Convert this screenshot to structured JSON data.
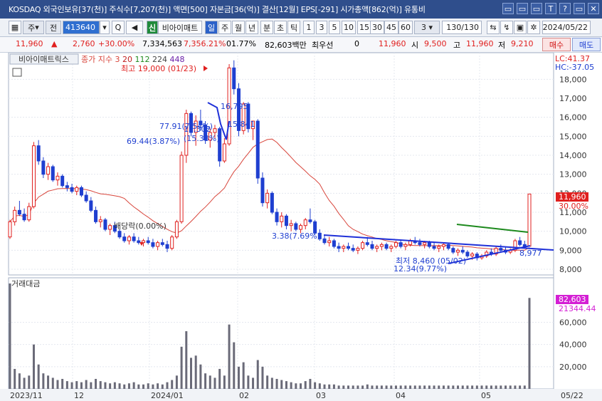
{
  "titlebar": {
    "title": "KOSDAQ 외국인보유[37(천)] 주식수[7,207(천)] 액면[500] 자본금[36(억)] 결산[12월] EPS[-291] 시가총액[862(억)] 유통비",
    "buttons": [
      "▭",
      "▭",
      "▭",
      "T",
      "?",
      "│",
      "▭",
      "✕"
    ]
  },
  "toolbar": {
    "grid_icon": "▦",
    "dropdown_1": "주",
    "dropdown_2": "전",
    "code": "413640",
    "zoom_icon": "Q",
    "speaker_icon": "◀",
    "badge": "신",
    "stock_name": "비아이매트",
    "periods": [
      "일",
      "주",
      "월",
      "년",
      "분",
      "초",
      "틱"
    ],
    "intervals": [
      "1",
      "3",
      "5",
      "10",
      "15",
      "30",
      "45",
      "60"
    ],
    "interval_select": "3",
    "count": "130",
    "count_total": "/130",
    "date": "2024/05/22"
  },
  "pricebar": {
    "price": "11,960",
    "change": "2,760",
    "change_pct": "+30.00%",
    "volume": "7,334,563",
    "volume_pct": "7,356.21%",
    "turnover": "01.77%",
    "trade_value": "82,603백만",
    "priority_label": "최우선",
    "priority_value": "0",
    "current": "11,960",
    "open_label": "시",
    "open": "9,500",
    "high_label": "고",
    "high": "11,960",
    "low_label": "저",
    "low": "9,210",
    "buy": "매수",
    "sell": "매도"
  },
  "chart": {
    "stock_label": "비아이매트릭스",
    "ma_legend_prefix": "종가 지수",
    "ma_periods": [
      "3",
      "20",
      "112",
      "224",
      "448"
    ],
    "lc_label": "LC:41.37",
    "hc_label": "HC:-37.05",
    "price_axis": [
      "18,000",
      "17,000",
      "16,000",
      "15,000",
      "14,000",
      "13,000",
      "12,000",
      "11,000",
      "10,000",
      "9,000",
      "8,000"
    ],
    "current_price_tag": "11,960",
    "current_pct_tag": "30.00%",
    "annotations": {
      "high": "최고 19,000 (01/23)",
      "low": "최저 8,460 (05/02)",
      "dividend": "배당락(0.00%)",
      "a1": "16,795",
      "a2": "15,841",
      "a3": "77.91(7.54%)",
      "a4": "69.44(3.87%)",
      "a5": "15,302",
      "a6": "(15.33%)",
      "a7": "3.38(7.69%)",
      "a8": "12.34(9.77%)",
      "a9": "8,977"
    },
    "volume_label": "거래대금",
    "volume_axis": [
      "60,000",
      "40,000",
      "20,000"
    ],
    "volume_tag": "82,603",
    "volume_tag2": "21344.44",
    "date_axis": [
      "2023/11",
      "12",
      "2024/01",
      "02",
      "03",
      "04",
      "05",
      "05/22"
    ]
  },
  "colors": {
    "up": "#e0201f",
    "down": "#1f3fd0",
    "ma20": "#d8453b",
    "trendline": "#1f30d8",
    "green_line": "#1e8a1e",
    "volume_bar": "#6a6a78"
  },
  "chart_data": {
    "type": "candlestick",
    "dates_start": "2023/11",
    "dates_end": "2024/05/22",
    "price_range": [
      7700,
      19400
    ],
    "candles": [
      [
        9700,
        10600,
        9600,
        10500
      ],
      [
        10500,
        11300,
        10300,
        11100
      ],
      [
        11100,
        11600,
        10800,
        10900
      ],
      [
        10900,
        11200,
        10500,
        10600
      ],
      [
        10600,
        11500,
        10500,
        11300
      ],
      [
        11300,
        14700,
        11200,
        14500
      ],
      [
        14500,
        14800,
        13500,
        13700
      ],
      [
        13700,
        13900,
        12800,
        13000
      ],
      [
        13000,
        13600,
        12700,
        13400
      ],
      [
        13400,
        13500,
        12600,
        12700
      ],
      [
        12700,
        13100,
        12400,
        12900
      ],
      [
        12900,
        13000,
        12300,
        12400
      ],
      [
        12400,
        12600,
        12100,
        12300
      ],
      [
        12300,
        12500,
        12000,
        12100
      ],
      [
        12100,
        12400,
        11900,
        12300
      ],
      [
        12300,
        12400,
        11800,
        11900
      ],
      [
        11900,
        12100,
        11500,
        11600
      ],
      [
        11600,
        11800,
        11000,
        11100
      ],
      [
        11100,
        11300,
        10400,
        10500
      ],
      [
        10500,
        10800,
        10200,
        10600
      ],
      [
        10600,
        10700,
        10000,
        10100
      ],
      [
        10100,
        10400,
        9800,
        10300
      ],
      [
        10300,
        10500,
        9900,
        10000
      ],
      [
        10000,
        10100,
        9600,
        9700
      ],
      [
        9700,
        9900,
        9400,
        9500
      ],
      [
        9500,
        9800,
        9300,
        9700
      ],
      [
        9700,
        9900,
        9400,
        9500
      ],
      [
        9500,
        9700,
        9300,
        9400
      ],
      [
        9400,
        9600,
        9200,
        9500
      ],
      [
        9500,
        9700,
        9300,
        9400
      ],
      [
        9400,
        9600,
        9100,
        9200
      ],
      [
        9200,
        9500,
        9000,
        9400
      ],
      [
        9400,
        9600,
        9200,
        9300
      ],
      [
        9300,
        9500,
        8900,
        9100
      ],
      [
        9100,
        9800,
        9000,
        9700
      ],
      [
        9700,
        10600,
        9600,
        10500
      ],
      [
        10500,
        14200,
        10400,
        14000
      ],
      [
        14000,
        16400,
        13600,
        16200
      ],
      [
        16200,
        16300,
        15000,
        15200
      ],
      [
        15200,
        16100,
        14500,
        15800
      ],
      [
        15800,
        16400,
        15300,
        15600
      ],
      [
        15600,
        15800,
        14600,
        14800
      ],
      [
        14800,
        15400,
        14400,
        15200
      ],
      [
        15200,
        15600,
        14900,
        15400
      ],
      [
        15400,
        15500,
        13400,
        13700
      ],
      [
        13700,
        14900,
        13600,
        14600
      ],
      [
        14600,
        18800,
        14500,
        18600
      ],
      [
        18600,
        19000,
        17200,
        17500
      ],
      [
        17500,
        17800,
        15000,
        15300
      ],
      [
        15300,
        16800,
        15100,
        16700
      ],
      [
        16700,
        16800,
        15200,
        15400
      ],
      [
        15400,
        15800,
        14800,
        15800
      ],
      [
        15800,
        15900,
        12500,
        12800
      ],
      [
        12800,
        13100,
        11300,
        11500
      ],
      [
        11500,
        12200,
        11200,
        12000
      ],
      [
        12000,
        12100,
        10900,
        11000
      ],
      [
        11000,
        11200,
        10300,
        10500
      ],
      [
        10500,
        11000,
        10200,
        10800
      ],
      [
        10800,
        10900,
        10100,
        10300
      ],
      [
        10300,
        10600,
        10000,
        10400
      ],
      [
        10400,
        10500,
        10000,
        10100
      ],
      [
        10100,
        10400,
        9900,
        10300
      ],
      [
        10300,
        10700,
        10100,
        10600
      ],
      [
        10600,
        11200,
        10400,
        10500
      ],
      [
        10500,
        10600,
        9800,
        9900
      ],
      [
        9900,
        10100,
        9500,
        9600
      ],
      [
        9600,
        9800,
        9300,
        9400
      ],
      [
        9400,
        9700,
        9200,
        9500
      ],
      [
        9500,
        9600,
        9100,
        9200
      ],
      [
        9200,
        9400,
        8900,
        9100
      ],
      [
        9100,
        9300,
        8900,
        9200
      ],
      [
        9200,
        9400,
        9000,
        9100
      ],
      [
        9100,
        9300,
        8900,
        9000
      ],
      [
        9000,
        9200,
        8800,
        9100
      ],
      [
        9100,
        9500,
        9000,
        9400
      ],
      [
        9400,
        9700,
        9200,
        9300
      ],
      [
        9300,
        9500,
        9000,
        9100
      ],
      [
        9100,
        9300,
        8900,
        9200
      ],
      [
        9200,
        9400,
        9000,
        9300
      ],
      [
        9300,
        9400,
        9000,
        9100
      ],
      [
        9100,
        9300,
        8900,
        9200
      ],
      [
        9200,
        9500,
        9100,
        9400
      ],
      [
        9400,
        9500,
        9100,
        9200
      ],
      [
        9200,
        9400,
        9000,
        9300
      ],
      [
        9300,
        9600,
        9200,
        9500
      ],
      [
        9500,
        9700,
        9300,
        9400
      ],
      [
        9400,
        9600,
        9200,
        9300
      ],
      [
        9300,
        9500,
        9100,
        9400
      ],
      [
        9400,
        9500,
        9100,
        9200
      ],
      [
        9200,
        9400,
        9000,
        9100
      ],
      [
        9100,
        9300,
        8900,
        9200
      ],
      [
        9200,
        9400,
        9000,
        9300
      ],
      [
        9300,
        9400,
        9000,
        9100
      ],
      [
        9100,
        9200,
        8800,
        8900
      ],
      [
        8900,
        9100,
        8700,
        9000
      ],
      [
        9000,
        9200,
        8800,
        8900
      ],
      [
        8900,
        9000,
        8600,
        8700
      ],
      [
        8700,
        8900,
        8500,
        8800
      ],
      [
        8800,
        8900,
        8460,
        8600
      ],
      [
        8600,
        8800,
        8500,
        8700
      ],
      [
        8700,
        9000,
        8600,
        8900
      ],
      [
        8900,
        9100,
        8700,
        8800
      ],
      [
        8800,
        9200,
        8700,
        9100
      ],
      [
        9100,
        9300,
        8900,
        9000
      ],
      [
        9000,
        9200,
        8800,
        8900
      ],
      [
        8900,
        9100,
        8800,
        9000
      ],
      [
        9000,
        9600,
        8900,
        9500
      ],
      [
        9500,
        9700,
        9200,
        9300
      ],
      [
        9300,
        9500,
        9100,
        9200
      ],
      [
        9210,
        11960,
        9210,
        11960
      ]
    ],
    "volume": [
      95,
      18,
      14,
      10,
      12,
      40,
      22,
      14,
      12,
      10,
      8,
      9,
      7,
      6,
      7,
      6,
      8,
      6,
      9,
      7,
      6,
      5,
      6,
      5,
      4,
      5,
      6,
      4,
      4,
      5,
      4,
      5,
      4,
      6,
      8,
      12,
      38,
      52,
      28,
      30,
      22,
      14,
      12,
      10,
      18,
      12,
      58,
      42,
      20,
      24,
      12,
      10,
      26,
      20,
      12,
      10,
      9,
      8,
      7,
      6,
      5,
      5,
      7,
      9,
      6,
      5,
      4,
      4,
      4,
      3,
      3,
      3,
      3,
      3,
      3,
      4,
      3,
      3,
      3,
      3,
      3,
      3,
      3,
      3,
      3,
      3,
      3,
      3,
      3,
      3,
      3,
      3,
      3,
      3,
      3,
      3,
      3,
      3,
      3,
      3,
      3,
      3,
      3,
      3,
      3,
      3,
      3,
      3,
      3,
      82
    ]
  }
}
